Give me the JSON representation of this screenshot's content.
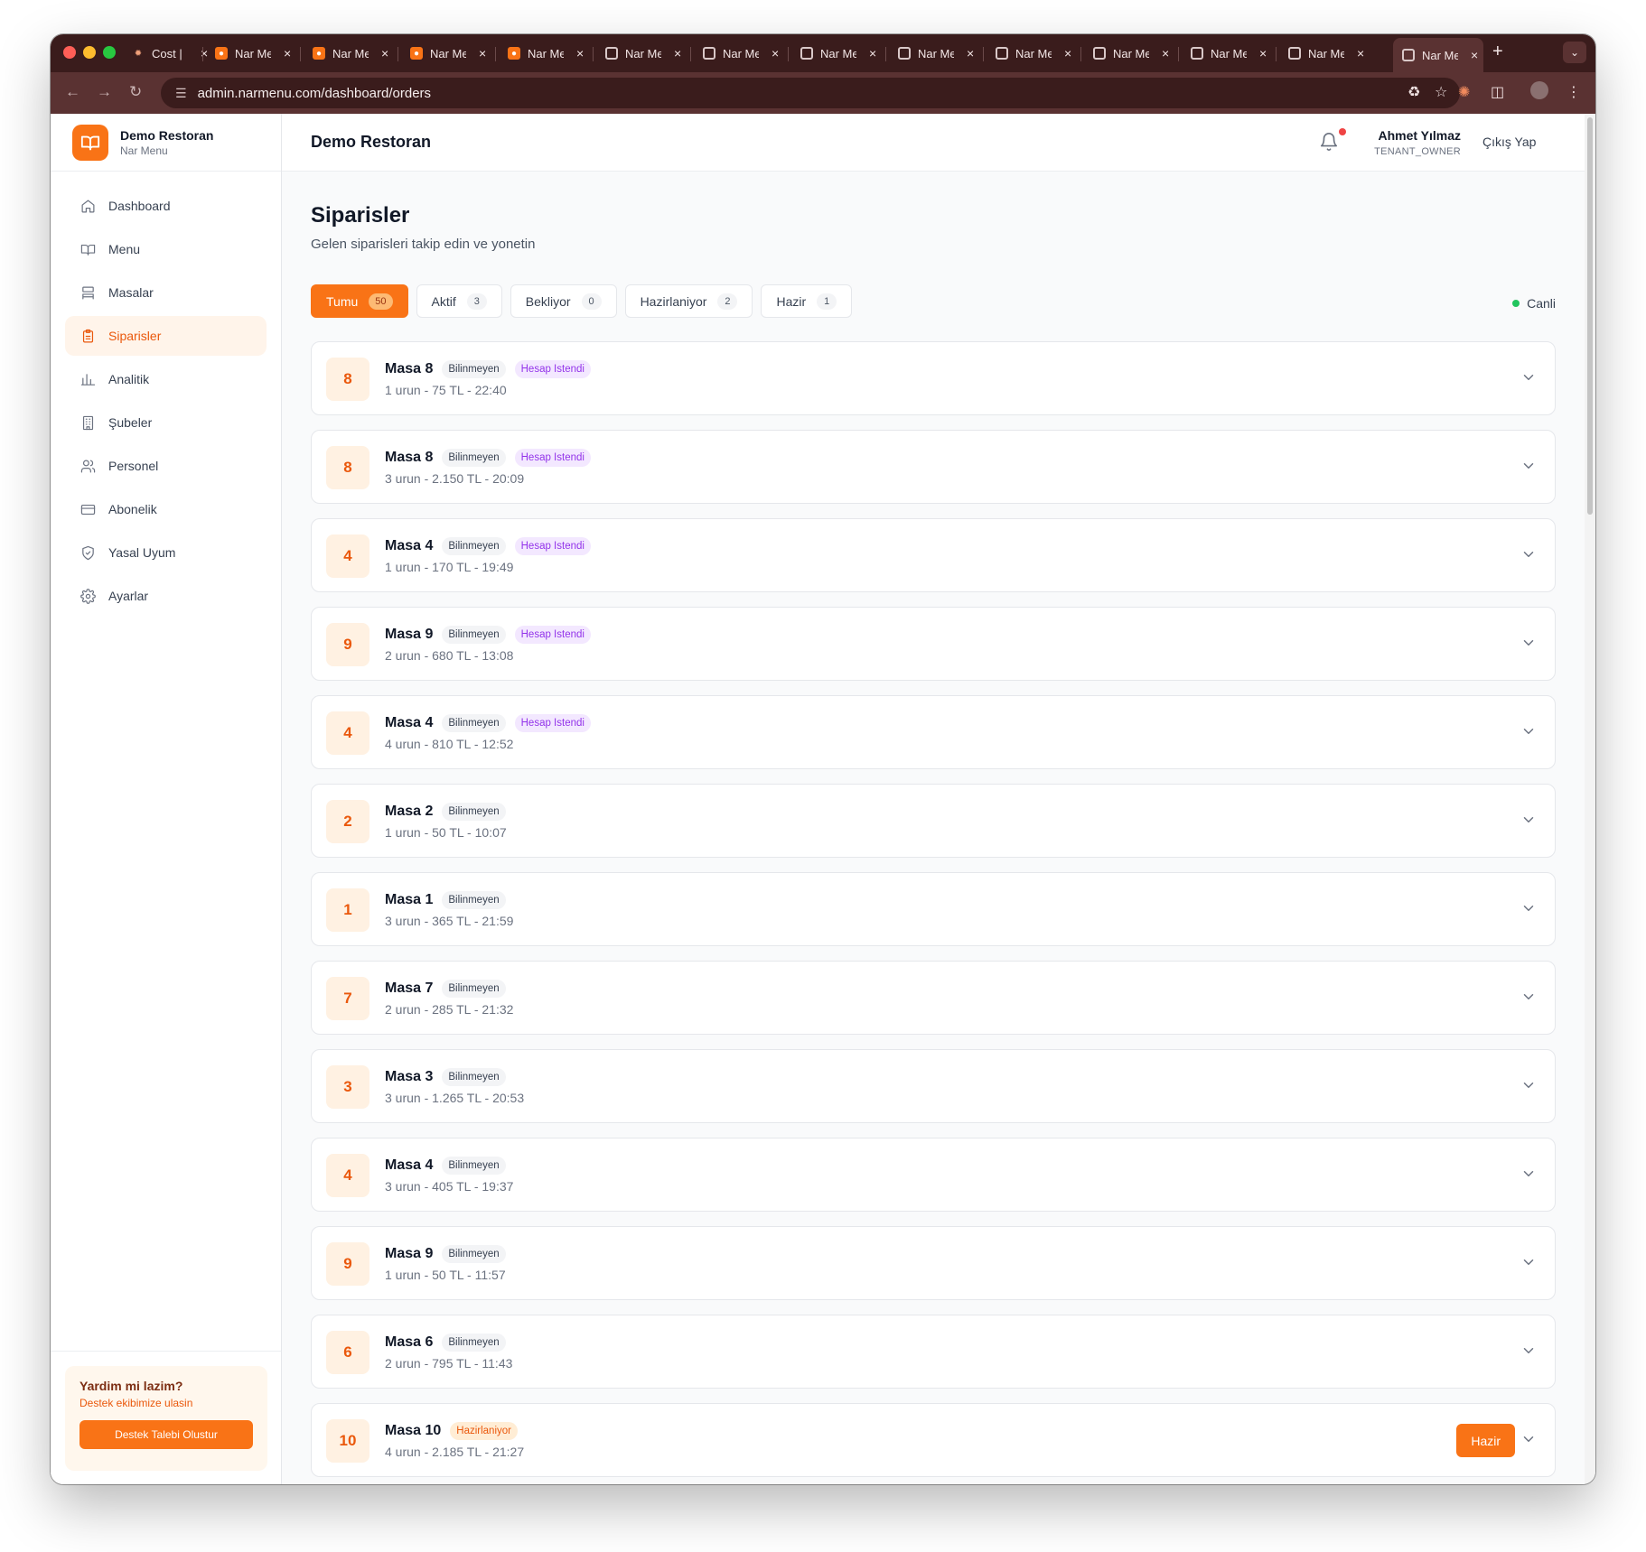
{
  "browser": {
    "tabs": [
      {
        "label": "Cost |",
        "favicon": "spark-icon"
      },
      {
        "label": "Nar Me",
        "favicon": "nar-icon"
      },
      {
        "label": "Nar Me",
        "favicon": "nar-icon"
      },
      {
        "label": "Nar Me",
        "favicon": "nar-icon"
      },
      {
        "label": "Nar Me",
        "favicon": "nar-icon"
      },
      {
        "label": "Nar Me",
        "favicon": "globe-icon"
      },
      {
        "label": "Nar Me",
        "favicon": "globe-icon"
      },
      {
        "label": "Nar Me",
        "favicon": "globe-icon"
      },
      {
        "label": "Nar Me",
        "favicon": "globe-icon"
      },
      {
        "label": "Nar Me",
        "favicon": "globe-icon"
      },
      {
        "label": "Nar Me",
        "favicon": "globe-icon"
      },
      {
        "label": "Nar Me",
        "favicon": "globe-icon"
      },
      {
        "label": "Nar Me",
        "favicon": "globe-icon"
      },
      {
        "label": "Nar Me",
        "favicon": "globe-icon",
        "active": true
      }
    ],
    "url": "admin.narmenu.com/dashboard/orders"
  },
  "sidebar": {
    "brand_name": "Demo Restoran",
    "brand_sub": "Nar Menu",
    "items": [
      {
        "label": "Dashboard",
        "icon": "home-icon"
      },
      {
        "label": "Menu",
        "icon": "book-icon"
      },
      {
        "label": "Masalar",
        "icon": "table-icon"
      },
      {
        "label": "Siparisler",
        "icon": "clipboard-icon",
        "active": true
      },
      {
        "label": "Analitik",
        "icon": "chart-icon"
      },
      {
        "label": "Şubeler",
        "icon": "building-icon"
      },
      {
        "label": "Personel",
        "icon": "users-icon"
      },
      {
        "label": "Abonelik",
        "icon": "card-icon"
      },
      {
        "label": "Yasal Uyum",
        "icon": "shield-icon"
      },
      {
        "label": "Ayarlar",
        "icon": "gear-icon"
      }
    ],
    "help": {
      "title": "Yardim mi lazim?",
      "sub": "Destek ekibimize ulasin",
      "button": "Destek Talebi Olustur"
    }
  },
  "header": {
    "title": "Demo Restoran",
    "user_name": "Ahmet Yılmaz",
    "user_role": "TENANT_OWNER",
    "logout": "Çıkış Yap"
  },
  "page": {
    "title": "Siparisler",
    "subtitle": "Gelen siparisleri takip edin ve yonetin",
    "live": "Canli",
    "filters": [
      {
        "label": "Tumu",
        "count": "50",
        "active": true
      },
      {
        "label": "Aktif",
        "count": "3"
      },
      {
        "label": "Bekliyor",
        "count": "0"
      },
      {
        "label": "Hazirlaniyor",
        "count": "2"
      },
      {
        "label": "Hazir",
        "count": "1"
      }
    ]
  },
  "orders": [
    {
      "table": "8",
      "name": "Masa 8",
      "customer": "Bilinmeyen",
      "status": "Hesap Istendi",
      "status_color": "#9333ea",
      "meta": "1 urun - 75 TL - 22:40"
    },
    {
      "table": "8",
      "name": "Masa 8",
      "customer": "Bilinmeyen",
      "status": "Hesap Istendi",
      "status_color": "#9333ea",
      "meta": "3 urun - 2.150 TL - 20:09"
    },
    {
      "table": "4",
      "name": "Masa 4",
      "customer": "Bilinmeyen",
      "status": "Hesap Istendi",
      "status_color": "#9333ea",
      "meta": "1 urun - 170 TL - 19:49"
    },
    {
      "table": "9",
      "name": "Masa 9",
      "customer": "Bilinmeyen",
      "status": "Hesap Istendi",
      "status_color": "#9333ea",
      "meta": "2 urun - 680 TL - 13:08"
    },
    {
      "table": "4",
      "name": "Masa 4",
      "customer": "Bilinmeyen",
      "status": "Hesap Istendi",
      "status_color": "#9333ea",
      "meta": "4 urun - 810 TL - 12:52"
    },
    {
      "table": "2",
      "name": "Masa 2",
      "customer": "Bilinmeyen",
      "status": "",
      "meta": "1 urun - 50 TL - 10:07"
    },
    {
      "table": "1",
      "name": "Masa 1",
      "customer": "Bilinmeyen",
      "status": "",
      "meta": "3 urun - 365 TL - 21:59"
    },
    {
      "table": "7",
      "name": "Masa 7",
      "customer": "Bilinmeyen",
      "status": "",
      "meta": "2 urun - 285 TL - 21:32"
    },
    {
      "table": "3",
      "name": "Masa 3",
      "customer": "Bilinmeyen",
      "status": "",
      "meta": "3 urun - 1.265 TL - 20:53"
    },
    {
      "table": "4",
      "name": "Masa 4",
      "customer": "Bilinmeyen",
      "status": "",
      "meta": "3 urun - 405 TL - 19:37"
    },
    {
      "table": "9",
      "name": "Masa 9",
      "customer": "Bilinmeyen",
      "status": "",
      "meta": "1 urun - 50 TL - 11:57"
    },
    {
      "table": "6",
      "name": "Masa 6",
      "customer": "Bilinmeyen",
      "status": "",
      "meta": "2 urun - 795 TL - 11:43"
    },
    {
      "table": "10",
      "name": "Masa 10",
      "customer": "",
      "status": "Hazirlaniyor",
      "status_color": "#ea580c",
      "meta": "4 urun - 2.185 TL - 21:27",
      "action": "Hazir"
    }
  ],
  "colors": {
    "accent": "#f97316",
    "chrome": "#3a1c1c"
  }
}
